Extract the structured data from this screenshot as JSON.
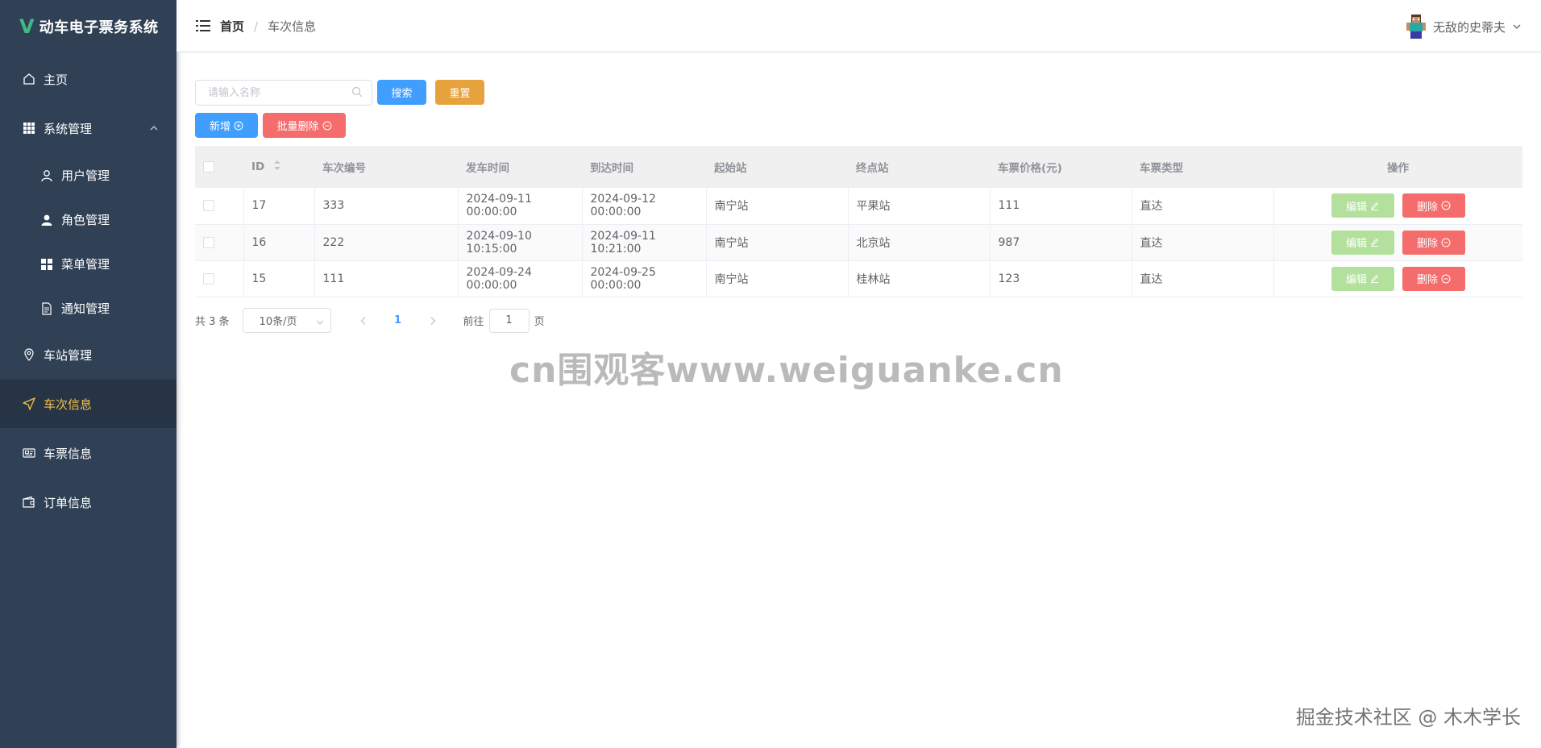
{
  "app": {
    "logo_letter": "V",
    "title": "动车电子票务系统"
  },
  "sidebar": {
    "items": [
      {
        "label": "主页",
        "icon": "home-icon"
      },
      {
        "label": "系统管理",
        "icon": "grid-icon"
      },
      {
        "label": "用户管理",
        "icon": "user-icon"
      },
      {
        "label": "角色管理",
        "icon": "user-filled-icon"
      },
      {
        "label": "菜单管理",
        "icon": "menu-icon"
      },
      {
        "label": "通知管理",
        "icon": "document-icon"
      },
      {
        "label": "车站管理",
        "icon": "location-icon"
      },
      {
        "label": "车次信息",
        "icon": "position-icon"
      },
      {
        "label": "车票信息",
        "icon": "ticket-icon"
      },
      {
        "label": "订单信息",
        "icon": "wallet-icon"
      }
    ],
    "active": "车次信息",
    "colors": {
      "bg": "#304156",
      "active_bg": "#263445",
      "active_text": "#f4c048"
    }
  },
  "header": {
    "breadcrumb_home": "首页",
    "breadcrumb_sep": "/",
    "breadcrumb_current": "车次信息",
    "username": "无敌的史蒂夫"
  },
  "toolbar": {
    "search_placeholder": "请输入名称",
    "search_label": "搜索",
    "reset_label": "重置",
    "add_label": "新增",
    "batch_delete_label": "批量删除"
  },
  "table": {
    "columns": [
      "ID",
      "车次编号",
      "发车时间",
      "到达时间",
      "起始站",
      "终点站",
      "车票价格(元)",
      "车票类型",
      "操作"
    ],
    "rows": [
      {
        "id": "17",
        "code": "333",
        "depart": "2024-09-11 00:00:00",
        "arrive": "2024-09-12 00:00:00",
        "from": "南宁站",
        "to": "平果站",
        "price": "111",
        "type": "直达"
      },
      {
        "id": "16",
        "code": "222",
        "depart": "2024-09-10 10:15:00",
        "arrive": "2024-09-11 10:21:00",
        "from": "南宁站",
        "to": "北京站",
        "price": "987",
        "type": "直达"
      },
      {
        "id": "15",
        "code": "111",
        "depart": "2024-09-24 00:00:00",
        "arrive": "2024-09-25 00:00:00",
        "from": "南宁站",
        "to": "桂林站",
        "price": "123",
        "type": "直达"
      }
    ],
    "edit_label": "编辑",
    "delete_label": "删除"
  },
  "pagination": {
    "total": "共 3 条",
    "page_size": "10条/页",
    "current_page": "1",
    "jump_prefix": "前往",
    "jump_value": "1",
    "jump_suffix": "页"
  },
  "watermarks": {
    "center": "cn围观客www.weiguanke.cn",
    "corner": "掘金技术社区 @ 木木学长"
  }
}
